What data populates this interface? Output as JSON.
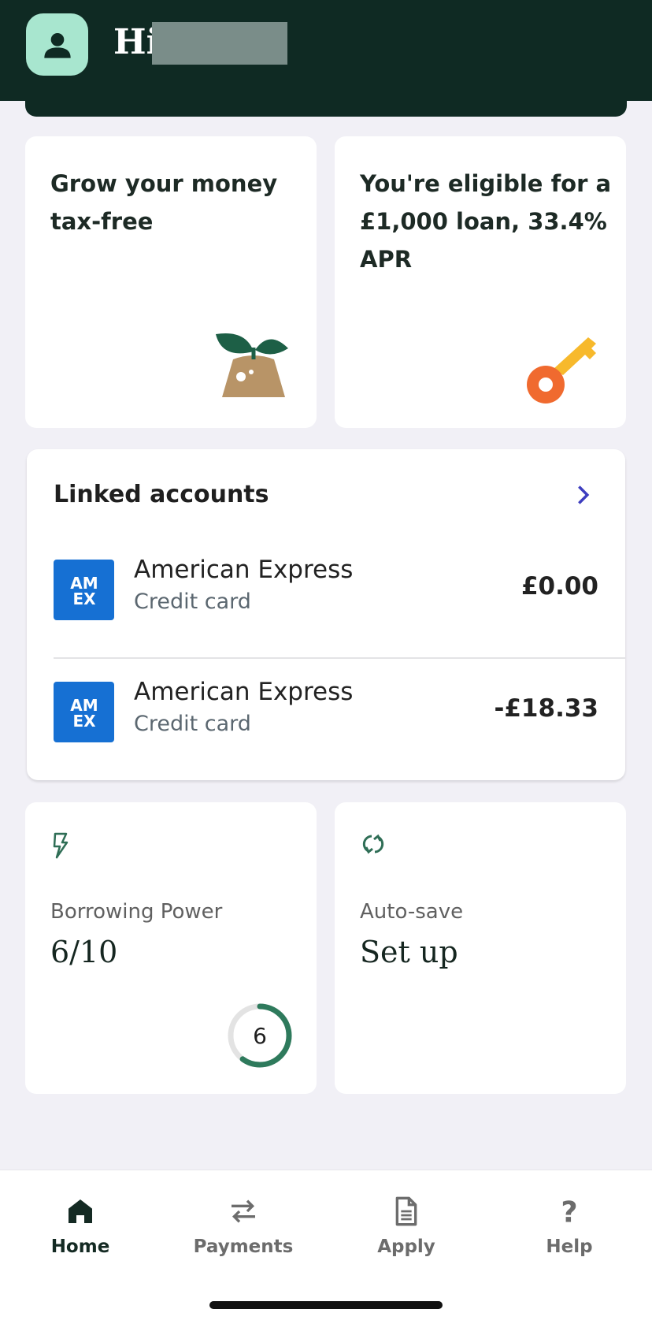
{
  "header": {
    "greeting": "Hi"
  },
  "promos": [
    {
      "title": "Grow your money tax-free",
      "icon": "plant-icon"
    },
    {
      "title": "You're eligible for a £1,000 loan, 33.4% APR",
      "icon": "key-icon"
    }
  ],
  "linked_accounts": {
    "title": "Linked accounts",
    "accounts": [
      {
        "name": "American Express",
        "type": "Credit card",
        "balance": "£0.00"
      },
      {
        "name": "American Express",
        "type": "Credit card",
        "balance": "-£18.33"
      }
    ]
  },
  "borrowing": {
    "label": "Borrowing Power",
    "value": "6/10",
    "score": "6",
    "score_fraction": 0.6
  },
  "autosave": {
    "label": "Auto-save",
    "value": "Set up"
  },
  "nav": [
    {
      "label": "Home",
      "icon": "home-icon",
      "active": true
    },
    {
      "label": "Payments",
      "icon": "transfer-icon"
    },
    {
      "label": "Apply",
      "icon": "document-icon"
    },
    {
      "label": "Help",
      "icon": "question-icon"
    }
  ],
  "colors": {
    "brand": "#0f2a23",
    "accent": "#a8e6cf",
    "amex": "#1670d3",
    "link": "#3d3dbf"
  }
}
